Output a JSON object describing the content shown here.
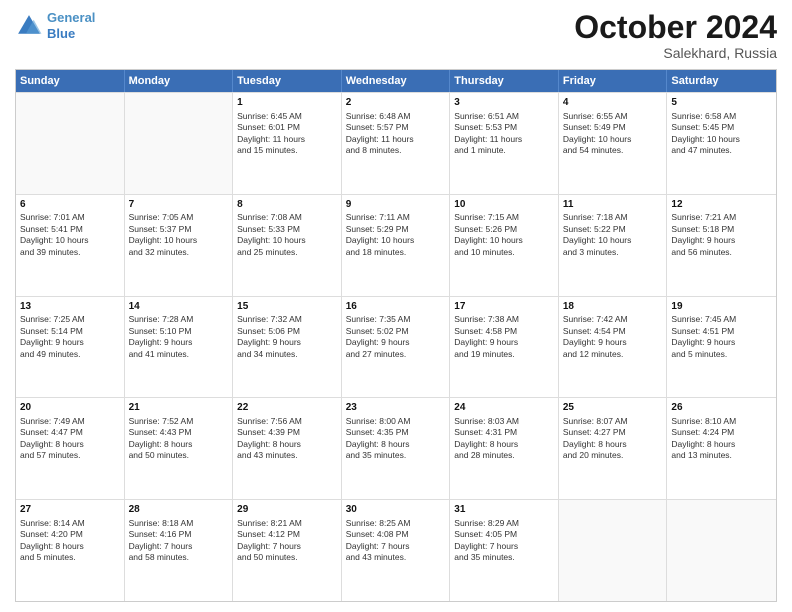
{
  "header": {
    "logo_line1": "General",
    "logo_line2": "Blue",
    "month_title": "October 2024",
    "location": "Salekhard, Russia"
  },
  "weekdays": [
    "Sunday",
    "Monday",
    "Tuesday",
    "Wednesday",
    "Thursday",
    "Friday",
    "Saturday"
  ],
  "rows": [
    [
      {
        "day": "",
        "lines": [],
        "empty": true
      },
      {
        "day": "",
        "lines": [],
        "empty": true
      },
      {
        "day": "1",
        "lines": [
          "Sunrise: 6:45 AM",
          "Sunset: 6:01 PM",
          "Daylight: 11 hours",
          "and 15 minutes."
        ],
        "empty": false
      },
      {
        "day": "2",
        "lines": [
          "Sunrise: 6:48 AM",
          "Sunset: 5:57 PM",
          "Daylight: 11 hours",
          "and 8 minutes."
        ],
        "empty": false
      },
      {
        "day": "3",
        "lines": [
          "Sunrise: 6:51 AM",
          "Sunset: 5:53 PM",
          "Daylight: 11 hours",
          "and 1 minute."
        ],
        "empty": false
      },
      {
        "day": "4",
        "lines": [
          "Sunrise: 6:55 AM",
          "Sunset: 5:49 PM",
          "Daylight: 10 hours",
          "and 54 minutes."
        ],
        "empty": false
      },
      {
        "day": "5",
        "lines": [
          "Sunrise: 6:58 AM",
          "Sunset: 5:45 PM",
          "Daylight: 10 hours",
          "and 47 minutes."
        ],
        "empty": false
      }
    ],
    [
      {
        "day": "6",
        "lines": [
          "Sunrise: 7:01 AM",
          "Sunset: 5:41 PM",
          "Daylight: 10 hours",
          "and 39 minutes."
        ],
        "empty": false
      },
      {
        "day": "7",
        "lines": [
          "Sunrise: 7:05 AM",
          "Sunset: 5:37 PM",
          "Daylight: 10 hours",
          "and 32 minutes."
        ],
        "empty": false
      },
      {
        "day": "8",
        "lines": [
          "Sunrise: 7:08 AM",
          "Sunset: 5:33 PM",
          "Daylight: 10 hours",
          "and 25 minutes."
        ],
        "empty": false
      },
      {
        "day": "9",
        "lines": [
          "Sunrise: 7:11 AM",
          "Sunset: 5:29 PM",
          "Daylight: 10 hours",
          "and 18 minutes."
        ],
        "empty": false
      },
      {
        "day": "10",
        "lines": [
          "Sunrise: 7:15 AM",
          "Sunset: 5:26 PM",
          "Daylight: 10 hours",
          "and 10 minutes."
        ],
        "empty": false
      },
      {
        "day": "11",
        "lines": [
          "Sunrise: 7:18 AM",
          "Sunset: 5:22 PM",
          "Daylight: 10 hours",
          "and 3 minutes."
        ],
        "empty": false
      },
      {
        "day": "12",
        "lines": [
          "Sunrise: 7:21 AM",
          "Sunset: 5:18 PM",
          "Daylight: 9 hours",
          "and 56 minutes."
        ],
        "empty": false
      }
    ],
    [
      {
        "day": "13",
        "lines": [
          "Sunrise: 7:25 AM",
          "Sunset: 5:14 PM",
          "Daylight: 9 hours",
          "and 49 minutes."
        ],
        "empty": false
      },
      {
        "day": "14",
        "lines": [
          "Sunrise: 7:28 AM",
          "Sunset: 5:10 PM",
          "Daylight: 9 hours",
          "and 41 minutes."
        ],
        "empty": false
      },
      {
        "day": "15",
        "lines": [
          "Sunrise: 7:32 AM",
          "Sunset: 5:06 PM",
          "Daylight: 9 hours",
          "and 34 minutes."
        ],
        "empty": false
      },
      {
        "day": "16",
        "lines": [
          "Sunrise: 7:35 AM",
          "Sunset: 5:02 PM",
          "Daylight: 9 hours",
          "and 27 minutes."
        ],
        "empty": false
      },
      {
        "day": "17",
        "lines": [
          "Sunrise: 7:38 AM",
          "Sunset: 4:58 PM",
          "Daylight: 9 hours",
          "and 19 minutes."
        ],
        "empty": false
      },
      {
        "day": "18",
        "lines": [
          "Sunrise: 7:42 AM",
          "Sunset: 4:54 PM",
          "Daylight: 9 hours",
          "and 12 minutes."
        ],
        "empty": false
      },
      {
        "day": "19",
        "lines": [
          "Sunrise: 7:45 AM",
          "Sunset: 4:51 PM",
          "Daylight: 9 hours",
          "and 5 minutes."
        ],
        "empty": false
      }
    ],
    [
      {
        "day": "20",
        "lines": [
          "Sunrise: 7:49 AM",
          "Sunset: 4:47 PM",
          "Daylight: 8 hours",
          "and 57 minutes."
        ],
        "empty": false
      },
      {
        "day": "21",
        "lines": [
          "Sunrise: 7:52 AM",
          "Sunset: 4:43 PM",
          "Daylight: 8 hours",
          "and 50 minutes."
        ],
        "empty": false
      },
      {
        "day": "22",
        "lines": [
          "Sunrise: 7:56 AM",
          "Sunset: 4:39 PM",
          "Daylight: 8 hours",
          "and 43 minutes."
        ],
        "empty": false
      },
      {
        "day": "23",
        "lines": [
          "Sunrise: 8:00 AM",
          "Sunset: 4:35 PM",
          "Daylight: 8 hours",
          "and 35 minutes."
        ],
        "empty": false
      },
      {
        "day": "24",
        "lines": [
          "Sunrise: 8:03 AM",
          "Sunset: 4:31 PM",
          "Daylight: 8 hours",
          "and 28 minutes."
        ],
        "empty": false
      },
      {
        "day": "25",
        "lines": [
          "Sunrise: 8:07 AM",
          "Sunset: 4:27 PM",
          "Daylight: 8 hours",
          "and 20 minutes."
        ],
        "empty": false
      },
      {
        "day": "26",
        "lines": [
          "Sunrise: 8:10 AM",
          "Sunset: 4:24 PM",
          "Daylight: 8 hours",
          "and 13 minutes."
        ],
        "empty": false
      }
    ],
    [
      {
        "day": "27",
        "lines": [
          "Sunrise: 8:14 AM",
          "Sunset: 4:20 PM",
          "Daylight: 8 hours",
          "and 5 minutes."
        ],
        "empty": false
      },
      {
        "day": "28",
        "lines": [
          "Sunrise: 8:18 AM",
          "Sunset: 4:16 PM",
          "Daylight: 7 hours",
          "and 58 minutes."
        ],
        "empty": false
      },
      {
        "day": "29",
        "lines": [
          "Sunrise: 8:21 AM",
          "Sunset: 4:12 PM",
          "Daylight: 7 hours",
          "and 50 minutes."
        ],
        "empty": false
      },
      {
        "day": "30",
        "lines": [
          "Sunrise: 8:25 AM",
          "Sunset: 4:08 PM",
          "Daylight: 7 hours",
          "and 43 minutes."
        ],
        "empty": false
      },
      {
        "day": "31",
        "lines": [
          "Sunrise: 8:29 AM",
          "Sunset: 4:05 PM",
          "Daylight: 7 hours",
          "and 35 minutes."
        ],
        "empty": false
      },
      {
        "day": "",
        "lines": [],
        "empty": true
      },
      {
        "day": "",
        "lines": [],
        "empty": true
      }
    ]
  ]
}
